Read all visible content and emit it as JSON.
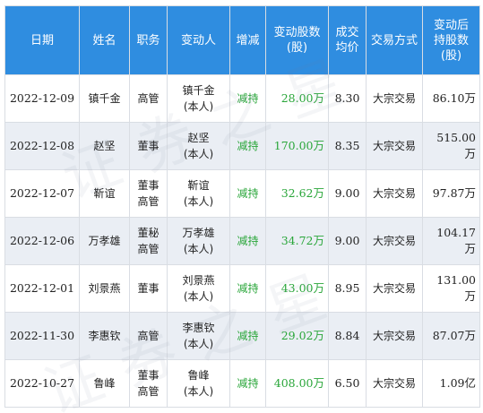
{
  "headers": [
    "日期",
    "姓名",
    "职务",
    "变动人",
    "增减",
    "变动股数\n(股)",
    "成交\n均价",
    "交易方式",
    "变动后\n持股数\n(股)"
  ],
  "rows": [
    {
      "date": "2022-12-09",
      "name": "镇千金",
      "role": "高管",
      "changer": "镇千金\n(本人)",
      "change": "减持",
      "shares": "28.00万",
      "price": "8.30",
      "method": "大宗交易",
      "after": "86.10万"
    },
    {
      "date": "2022-12-08",
      "name": "赵坚",
      "role": "董事",
      "changer": "赵坚\n(本人)",
      "change": "减持",
      "shares": "170.00万",
      "price": "8.35",
      "method": "大宗交易",
      "after": "515.00万"
    },
    {
      "date": "2022-12-07",
      "name": "靳谊",
      "role": "董事\n高管",
      "changer": "靳谊\n(本人)",
      "change": "减持",
      "shares": "32.62万",
      "price": "9.00",
      "method": "大宗交易",
      "after": "97.87万"
    },
    {
      "date": "2022-12-06",
      "name": "万孝雄",
      "role": "董秘\n高管",
      "changer": "万孝雄\n(本人)",
      "change": "减持",
      "shares": "34.72万",
      "price": "9.00",
      "method": "大宗交易",
      "after": "104.17万"
    },
    {
      "date": "2022-12-01",
      "name": "刘景燕",
      "role": "董事",
      "changer": "刘景燕\n(本人)",
      "change": "减持",
      "shares": "43.00万",
      "price": "8.95",
      "method": "大宗交易",
      "after": "131.00万"
    },
    {
      "date": "2022-11-30",
      "name": "李惠钦",
      "role": "高管",
      "changer": "李惠钦\n(本人)",
      "change": "减持",
      "shares": "29.02万",
      "price": "8.84",
      "method": "大宗交易",
      "after": "87.07万"
    },
    {
      "date": "2022-10-27",
      "name": "鲁峰",
      "role": "董事\n高管",
      "changer": "鲁峰\n(本人)",
      "change": "减持",
      "shares": "408.00万",
      "price": "6.50",
      "method": "大宗交易",
      "after": "1.09亿"
    }
  ],
  "watermark": "证券之星",
  "colors": {
    "header_bg": "#2f8de0",
    "alt_row": "#eaeef4",
    "green": "#2aa63a"
  }
}
